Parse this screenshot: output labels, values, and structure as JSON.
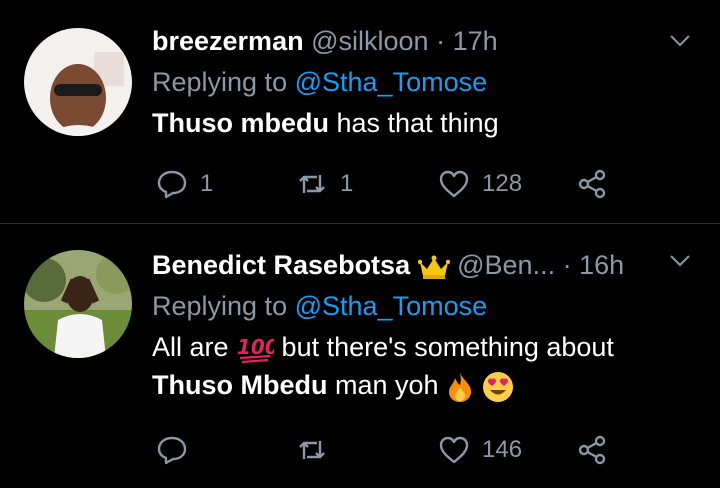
{
  "tweets": [
    {
      "display_name": "breezerman",
      "handle": "@silkloon",
      "separator": "·",
      "time": "17h",
      "replying_label": "Replying to",
      "replying_to": "@Stha_Tomose",
      "text_bold": "Thuso mbedu",
      "text_rest": " has that thing",
      "reply_count": "1",
      "retweet_count": "1",
      "like_count": "128"
    },
    {
      "display_name": "Benedict Rasebotsa",
      "badge_icon": "crown-icon",
      "handle": "@Ben...",
      "separator": "·",
      "time": "16h",
      "replying_label": "Replying to",
      "replying_to": "@Stha_Tomose",
      "line1_start": "All are ",
      "line1_emoji": "hundred-points-emoji",
      "line1_end": " but there's something about",
      "line2_bold": "Thuso Mbedu",
      "line2_rest": " man yoh",
      "line2_emojis": [
        "fire-emoji",
        "heart-eyes-emoji"
      ],
      "reply_count": "",
      "retweet_count": "",
      "like_count": "146"
    }
  ],
  "colors": {
    "background": "#000000",
    "secondary_text": "#8b98a5",
    "mention": "#1d9bf0",
    "divider": "#2f3336"
  }
}
